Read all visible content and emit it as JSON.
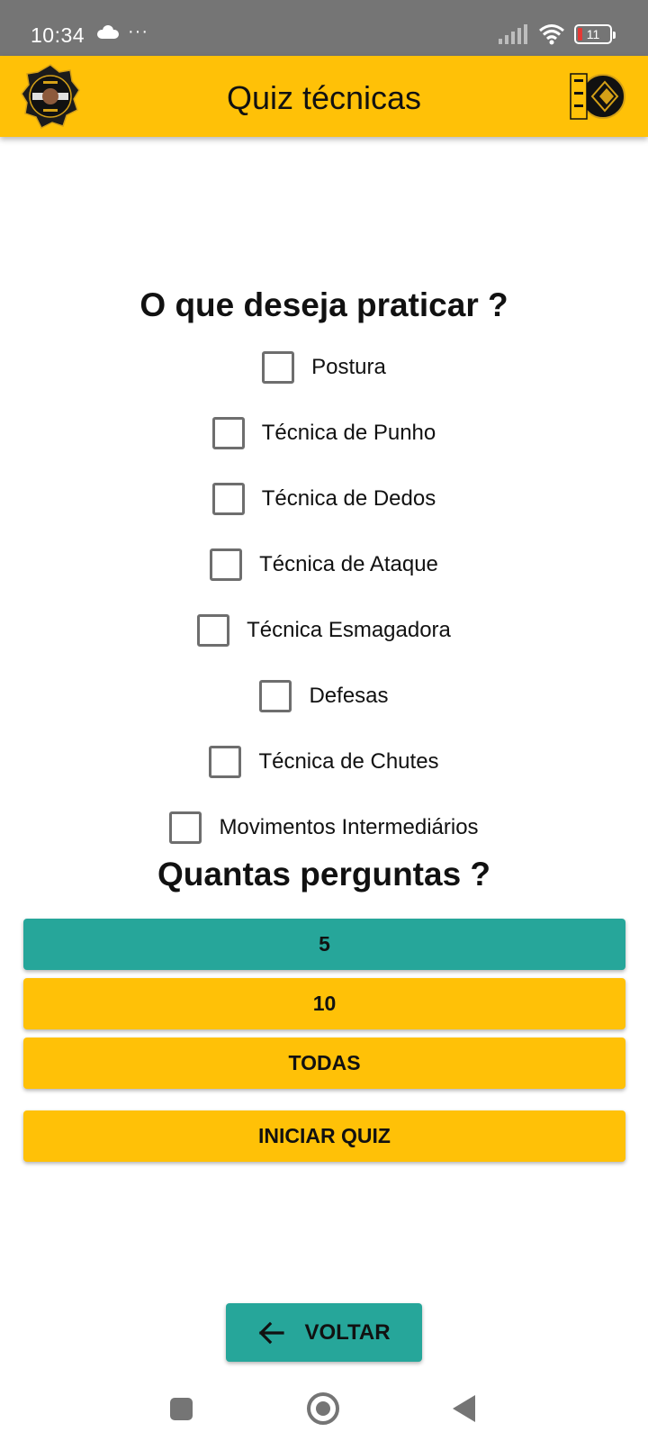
{
  "status_bar": {
    "time": "10:34",
    "left_icons": [
      "cloud-icon",
      "more-dots-icon"
    ],
    "right_icons": [
      "signal-icon",
      "wifi-icon",
      "battery-icon"
    ],
    "battery_level": "11",
    "battery_color": "#e53935"
  },
  "app_bar": {
    "title": "Quiz técnicas",
    "background": "#ffc107",
    "logo_left": "dojo-emblem-logo",
    "logo_right": "sankonryu-logo"
  },
  "practice": {
    "heading": "O que deseja praticar ?",
    "options": [
      {
        "label": "Postura",
        "checked": false
      },
      {
        "label": "Técnica de Punho",
        "checked": false
      },
      {
        "label": "Técnica de Dedos",
        "checked": false
      },
      {
        "label": "Técnica de Ataque",
        "checked": false
      },
      {
        "label": "Técnica Esmagadora",
        "checked": false
      },
      {
        "label": "Defesas",
        "checked": false
      },
      {
        "label": "Técnica de Chutes",
        "checked": false
      },
      {
        "label": "Movimentos Intermediários",
        "checked": false
      }
    ]
  },
  "count": {
    "heading": "Quantas perguntas ?",
    "options": [
      {
        "label": "5",
        "selected": true
      },
      {
        "label": "10",
        "selected": false
      },
      {
        "label": "TODAS",
        "selected": false
      }
    ],
    "start_label": "INICIAR QUIZ",
    "selected_color": "#26a69a",
    "default_color": "#ffc107"
  },
  "back": {
    "label": "VOLTAR",
    "icon": "arrow-left-icon"
  },
  "nav_bar": {
    "icons": [
      "recents-square-icon",
      "home-circle-icon",
      "back-triangle-icon"
    ]
  }
}
